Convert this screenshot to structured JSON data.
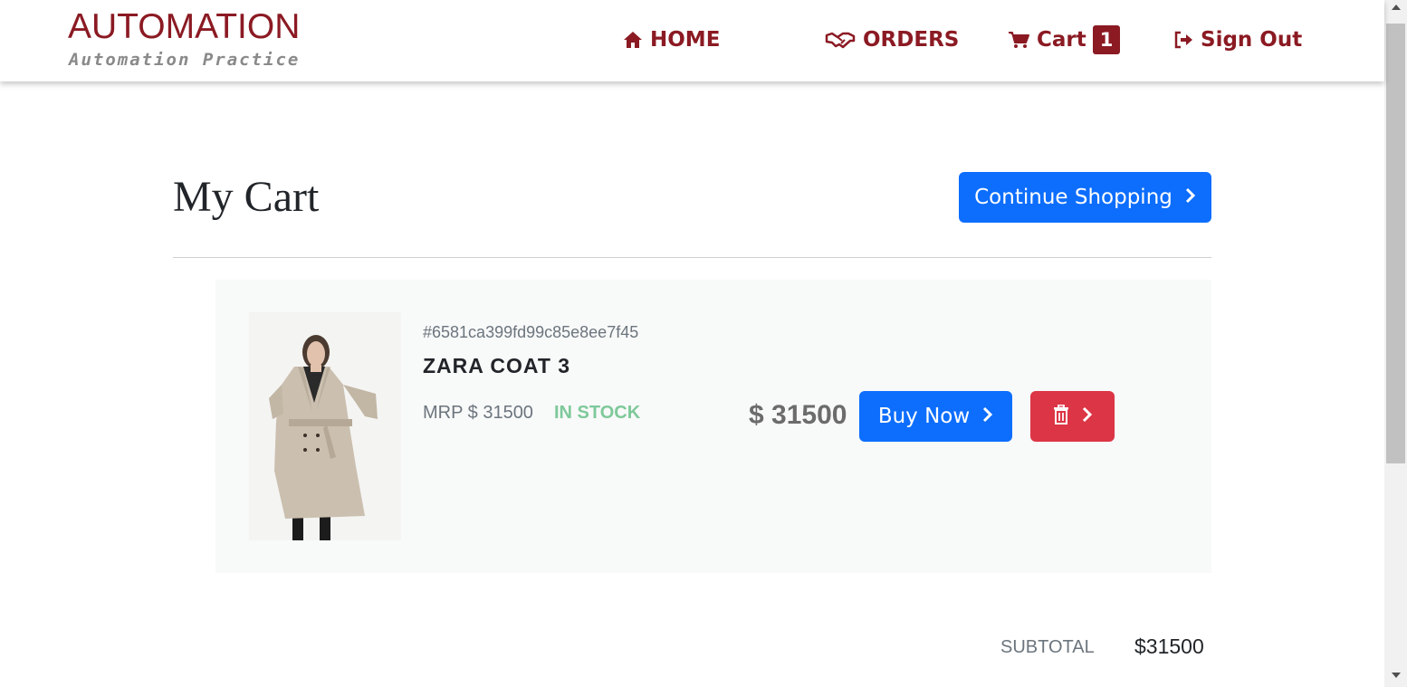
{
  "brand": {
    "title": "AUTOMATION",
    "subtitle": "Automation Practice",
    "color": "#8b1a23"
  },
  "nav": {
    "home": {
      "label": "HOME",
      "icon": "home-icon"
    },
    "orders": {
      "label": "ORDERS",
      "icon": "handshake-icon"
    },
    "cart": {
      "label": "Cart",
      "icon": "cart-icon",
      "count": "1"
    },
    "signout": {
      "label": "Sign Out",
      "icon": "sign-out-icon"
    }
  },
  "page": {
    "title": "My Cart",
    "continue_label": "Continue Shopping",
    "accent": "#0d6efd"
  },
  "cart_item": {
    "id": "#6581ca399fd99c85e8ee7f45",
    "name": "ZARA COAT 3",
    "mrp": "MRP $ 31500",
    "stock": "IN STOCK",
    "price": "$ 31500",
    "buy_label": "Buy Now",
    "delete_color": "#dc3545",
    "stock_color": "#7ec99a"
  },
  "summary": {
    "subtotal_label": "SUBTOTAL",
    "subtotal_value": "$31500"
  }
}
